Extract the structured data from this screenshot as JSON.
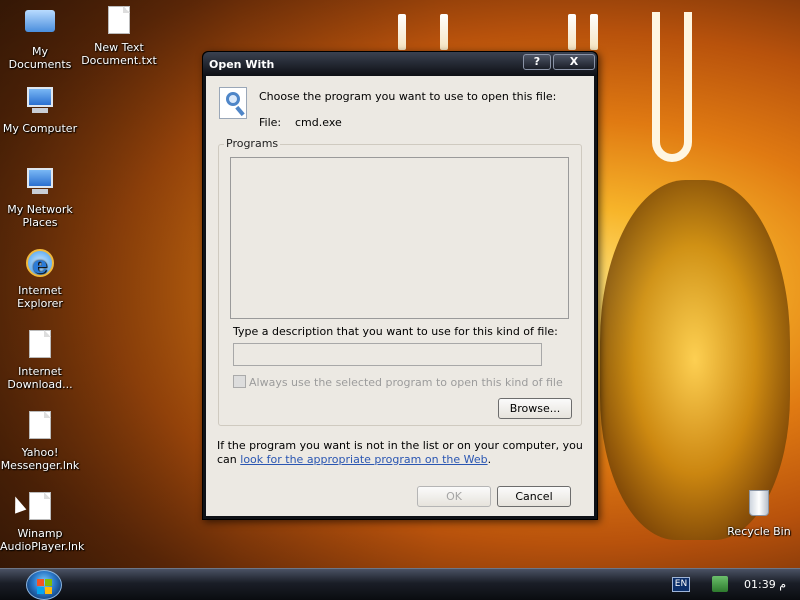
{
  "desktop": {
    "icons": [
      {
        "label": "My Documents",
        "icon": "my-documents-icon"
      },
      {
        "label": "New Text Document.txt",
        "icon": "text-document-icon"
      },
      {
        "label": "My Computer",
        "icon": "my-computer-icon"
      },
      {
        "label": "My Network Places",
        "icon": "network-places-icon"
      },
      {
        "label": "Internet Explorer",
        "icon": "internet-explorer-icon"
      },
      {
        "label": "Internet Download...",
        "icon": "file-icon"
      },
      {
        "label": "Yahoo! Messenger.lnk",
        "icon": "file-icon"
      },
      {
        "label": "Winamp AudioPlayer.lnk",
        "icon": "file-icon"
      },
      {
        "label": "Recycle Bin",
        "icon": "recycle-bin-icon"
      }
    ]
  },
  "dialog": {
    "title": "Open With",
    "help_button": "?",
    "close_button": "X",
    "instruction": "Choose the program you want to use to open this file:",
    "file_label": "File:",
    "file_name": "cmd.exe",
    "programs_group_label": "Programs",
    "description_label": "Type a description that you want to use for this kind of file:",
    "description_value": "",
    "always_use_label": "Always use the selected program to open this kind of file",
    "always_use_checked": false,
    "browse_button": "Browse...",
    "footer_text": "If the program you want is not in the list or on your computer, you can",
    "footer_link": "look for the appropriate program on the Web",
    "footer_end": ".",
    "ok_button": "OK",
    "cancel_button": "Cancel"
  },
  "taskbar": {
    "language": "EN",
    "clock": "01:39 م"
  }
}
